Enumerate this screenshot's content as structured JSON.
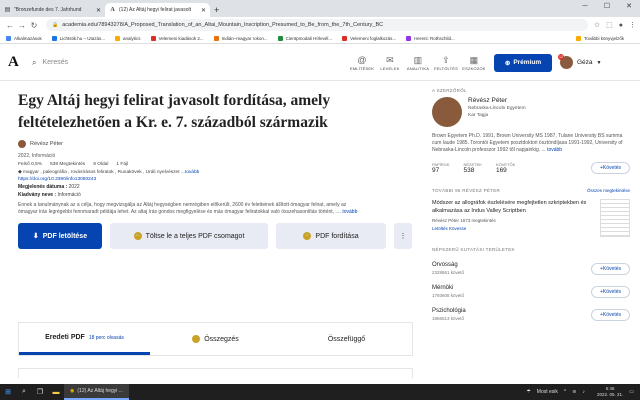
{
  "browser": {
    "tabs": [
      {
        "label": "\"Bronzefunde des 7. Jahrhund",
        "icon": "document-icon",
        "active": false
      },
      {
        "label": "(12) Az Altáj hegyi felirat javasolt",
        "icon": "academia-icon",
        "active": true
      }
    ],
    "url": "academia.edu/78943278/A_Proposed_Translation_of_an_Altai_Mountain_Inscription_Presumed_to_Be_from_the_7th_Century_BC",
    "bookmarks": [
      "Alkalmazások",
      "Lichtstik.hu – Utazás...",
      "analytics",
      "Velemeni kiadások 2...",
      "Indián–magyar rokon...",
      "Cientpmodali Hírlevél...",
      "Velemeni foglalkozás...",
      "Hereni: Rothschild..."
    ],
    "bookmarks_right": "További könyvjelzők"
  },
  "site": {
    "logo": "A",
    "search_placeholder": "Keresés",
    "menu": [
      "EMLÍTÉSEK",
      "LEVELEK",
      "ANALITIKA",
      "FELTÖLTÉS",
      "ESZKÖZÖK"
    ],
    "premium": "Prémium",
    "user": "Géza",
    "notifications": "12"
  },
  "paper": {
    "title": "Egy Altáj hegyi felirat javasolt fordítása, amely feltételezhetően a Kr. e. 7. századból származik",
    "author": "Révész Péter",
    "type": "2022, Információ",
    "stats": [
      "Felső 0,5%",
      "538 Megtekintés",
      "9 Oldal",
      "1 Fájl"
    ],
    "tags": "magyar , paleográfia , rovásírásos feliratok , Runakövek , Uráli nyelvészet",
    "tags_more": "...tovább",
    "doi": "https://doi.org/10.3390/info13050243",
    "pub_date_label": "Megjelenés dátuma :",
    "pub_date": "2022",
    "publisher_label": "Kiadvány neve :",
    "publisher": "Információ",
    "abstract": "Ennek a tanulmánynak az a célja, hogy megvizsgálja az Altáj hegységben nemrégiben előkerült, 2600 év feletteinek állított ómagyar felirat, amely az ómagyar írás legrégebbi fennmaradt példája lehet. Az altaj írás gondos megfigyelése és más ómagyar feliratokkal való összehasonlítás történt, ....",
    "abstract_more": "tovább",
    "btn_download": "PDF letöltése",
    "btn_package": "Töltse le a teljes PDF csomagot",
    "btn_translate": "PDF fordítása",
    "tabs": [
      "Eredeti PDF",
      "Összegzés",
      "Összefüggő"
    ],
    "tab_read": "18 perc olvasás"
  },
  "sidebar": {
    "author_header": "A SZERZŐRŐL",
    "name": "Révész Péter",
    "affil": "Nebraska-Lincoln Egyetem",
    "dept": "Kar Tagja",
    "bio": "Brown Egyetem Ph.D. 1991, Brown University MS 1987, Tulane University BS summa cum laude 1985. Torontói Egyetem posztdoktori ösztöndíjasa 1991-1992, University of Nebraska-Lincoln professzor 1992 től napjainkig. ...",
    "bio_more": "tovább",
    "counts": [
      {
        "label": "PAPÍROK",
        "value": "97"
      },
      {
        "label": "NÉZETEK",
        "value": "538"
      },
      {
        "label": "KÖVETŐK",
        "value": "169"
      }
    ],
    "follow": "Követés",
    "more_header": "TOVÁBBI 96 RÉVÉSZ PÉTER",
    "more_link": "Összes megtekintése",
    "paper_title": "Módszer az allográfok észlelésére megfejtetlen szkriptekben és alkalmazása az Indus Valley Scriptben",
    "paper_meta": "Révész Péter   1673 megtekintés",
    "paper_actions": "Letöltés   Kövesse",
    "fields_header": "NÉPSZERŰ KUTATÁSI TERÜLETEK",
    "fields": [
      {
        "name": "Orvosság",
        "count": "2328661 követő"
      },
      {
        "name": "Mérnöki",
        "count": "1793608 követő"
      },
      {
        "name": "Pszichológia",
        "count": "1866613 követő"
      }
    ]
  },
  "taskbar": {
    "app": "(12) Az Altáj hegyi ...",
    "tray_text": "Most esik",
    "time": "5:46",
    "date": "2022. 05. 21."
  }
}
